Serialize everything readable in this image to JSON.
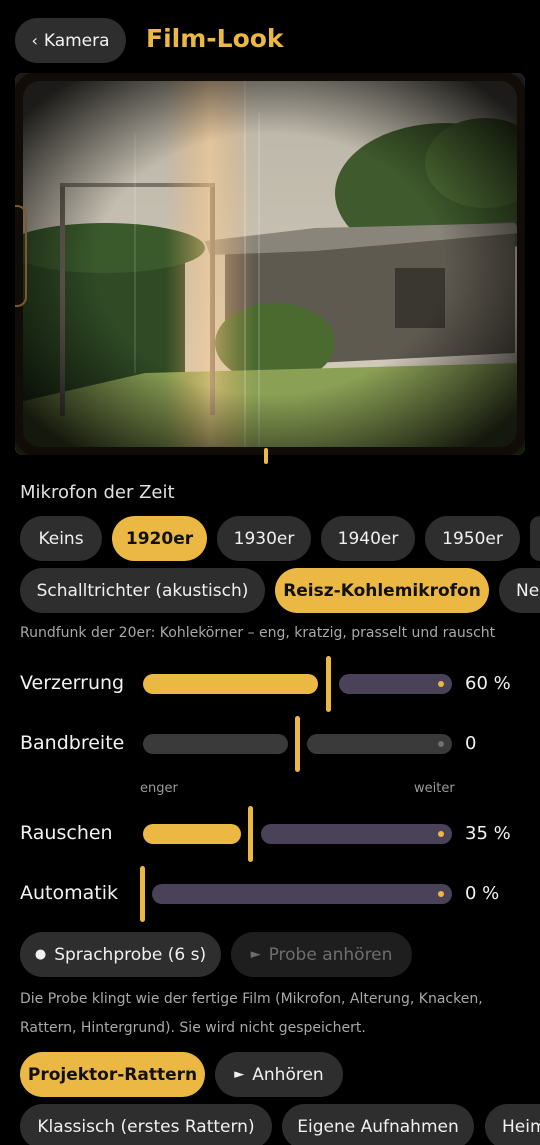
{
  "header": {
    "back_label": "Kamera",
    "title": "Film-Look"
  },
  "microphone": {
    "section_label": "Mikrofon der Zeit",
    "eras": [
      "Keins",
      "1920er",
      "1930er",
      "1940er",
      "1950er"
    ],
    "selected_era": "1920er",
    "types": [
      "Schalltrichter (akustisch)",
      "Reisz-Kohlemikrofon",
      "Ne"
    ],
    "selected_type": "Reisz-Kohlemikrofon",
    "description": "Rundfunk der 20er: Kohlekörner – eng, kratzig, prasselt und rauscht"
  },
  "sliders": {
    "distortion": {
      "label": "Verzerrung",
      "value_text": "60 %",
      "value": 0.6
    },
    "bandwidth": {
      "label": "Bandbreite",
      "value_text": "0",
      "value": 0.5,
      "min_label": "enger",
      "max_label": "weiter"
    },
    "noise": {
      "label": "Rauschen",
      "value_text": "35 %",
      "value": 0.35
    },
    "auto": {
      "label": "Automatik",
      "value_text": "0 %",
      "value": 0.0
    }
  },
  "sample": {
    "record_label": "Sprachprobe (6 s)",
    "play_label": "Probe anhören",
    "note_line1": "Die Probe klingt wie der fertige Film (Mikrofon, Alterung, Knacken,",
    "note_line2": "Rattern, Hintergrund). Sie wird nicht gespeichert."
  },
  "projector": {
    "label": "Projektor-Rattern",
    "listen_label": "Anhören",
    "presets": [
      "Klassisch (erstes Rattern)",
      "Eigene Aufnahmen",
      "Heim"
    ]
  },
  "colors": {
    "accent": "#ebb844",
    "chip": "#2e2e2e",
    "track_rest": "#4a4258"
  },
  "icons": {
    "back": "chevron-left-icon",
    "record": "record-dot-icon",
    "play": "play-icon"
  }
}
